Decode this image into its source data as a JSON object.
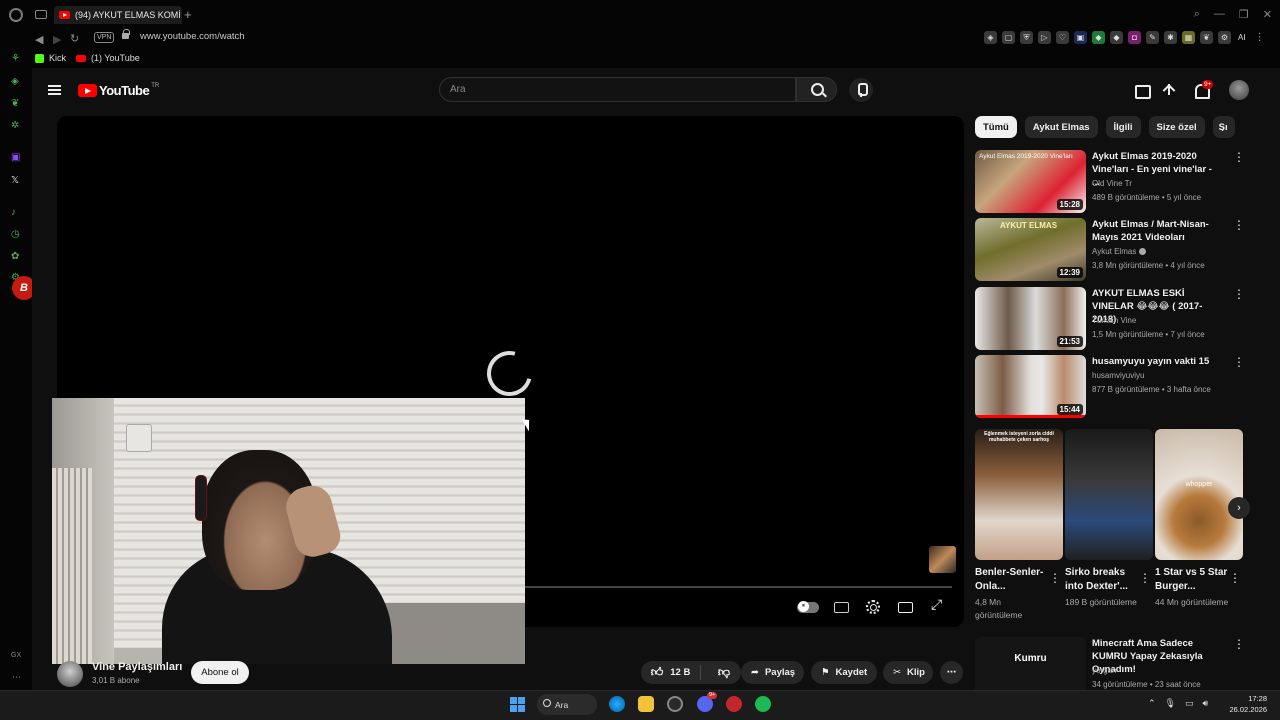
{
  "browser": {
    "tab_title": "(94) AYKUT ELMAS KOMİ",
    "url": "www.youtube.com/watch",
    "vpn_label": "VPN",
    "ai_label": "AI",
    "bookmarks": [
      {
        "label": "Kick"
      },
      {
        "label": "(1) YouTube"
      }
    ],
    "gx_label": "GX"
  },
  "youtube": {
    "logo_text": "YouTube",
    "country_code": "TR",
    "search_placeholder": "Ara",
    "notification_count": "9+"
  },
  "player": {
    "state": "loading",
    "overlay_logo_letter": "B"
  },
  "channel": {
    "name": "Vine Paylaşımları",
    "subscribers": "3,01 B abone",
    "subscribe_label": "Abone ol"
  },
  "actions": {
    "like_count": "12 B",
    "share_label": "Paylaş",
    "save_label": "Kaydet",
    "clip_label": "Klip"
  },
  "chips": [
    "Tümü",
    "Aykut Elmas",
    "İlgili",
    "Size özel",
    "Sı"
  ],
  "recommendations": [
    {
      "title": "Aykut Elmas 2019-2020 Vine'ları - En yeni vine'lar - ...",
      "channel": "Old Vine Tr",
      "meta": "489 B görüntüleme • 5 yıl önce",
      "duration": "15:28"
    },
    {
      "title": "Aykut Elmas / Mart-Nisan-Mayıs 2021 Videoları",
      "channel": "Aykut Elmas",
      "meta": "3,8 Mn görüntüleme • 4 yıl önce",
      "duration": "12:39"
    },
    {
      "title": "AYKUT ELMAS ESKİ VINELAR 😂😂😂 ( 2017-2018)",
      "channel": "Türkish Vine",
      "meta": "1,5 Mn görüntüleme • 7 yıl önce",
      "duration": "21:53"
    },
    {
      "title": "husamyuyu yayın vakti 15",
      "channel": "husamviyuviyu",
      "meta": "877 B görüntüleme • 3 hafta önce",
      "duration": "15:44"
    }
  ],
  "recommendation_thumb_texts": {
    "r1_overlay": "Aykut Elmas 2019-2020 Vine'ları",
    "r2_overlay": "AYKUT ELMAS"
  },
  "shorts": [
    {
      "title": "Benler-Senler-Onla...",
      "views": "4,8 Mn görüntüleme",
      "caption": "Eğlenmek isteyeni zorla ciddi muhabbete çeken sarhoş"
    },
    {
      "title": "Sirko breaks into Dexter'...",
      "views": "189 B görüntüleme",
      "caption": ""
    },
    {
      "title": "1 Star vs 5 Star Burger...",
      "views": "44 Mn görüntüleme",
      "caption": "whopper"
    }
  ],
  "last_rec": {
    "title": "Minecraft Ama Sadece KUMRU Yapay Zekasıyla Oynadım!",
    "channel": "yorgan",
    "meta": "34 görüntüleme • 23 saat önce",
    "thumb_text": "Kumru"
  },
  "taskbar": {
    "search_label": "Ara",
    "discord_badge": "9+",
    "time": "17:28",
    "date": "26.02.2026"
  },
  "colors": {
    "yt_red": "#ff0000",
    "background": "#0f0f0f",
    "kick_green": "#53fc18",
    "chip_active": "#f1f1f1"
  }
}
